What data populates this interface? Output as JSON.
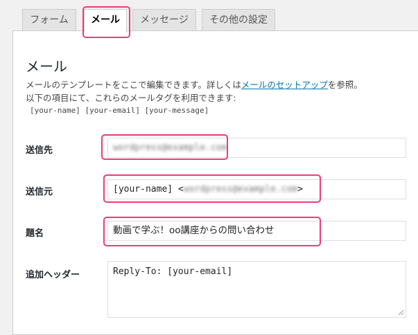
{
  "tabs": [
    {
      "label": "フォーム"
    },
    {
      "label": "メール"
    },
    {
      "label": "メッセージ"
    },
    {
      "label": "その他の設定"
    }
  ],
  "section": {
    "title": "メール",
    "desc_prefix": "メールのテンプレートをここで編集できます。詳しくは",
    "desc_link": "メールのセットアップ",
    "desc_suffix": "を参照。",
    "desc_line2": "以下の項目にて、これらのメールタグを利用できます:",
    "mail_tags": "[your-name] [your-email] [your-message]"
  },
  "fields": {
    "to": {
      "label": "送信先",
      "value": "wordpress@example.com"
    },
    "from": {
      "label": "送信元",
      "value_prefix": "[your-name] <",
      "value_blurred": "wordpress@example.com",
      "value_suffix": ">"
    },
    "subject": {
      "label": "題名",
      "value": "動画で学ぶ！oo講座からの問い合わせ"
    },
    "headers": {
      "label": "追加ヘッダー",
      "value": "Reply-To: [your-email]"
    }
  },
  "colors": {
    "highlight": "#ee3a7a",
    "link": "#0073aa"
  },
  "icons": {
    "resize": "resize-grip-icon"
  }
}
